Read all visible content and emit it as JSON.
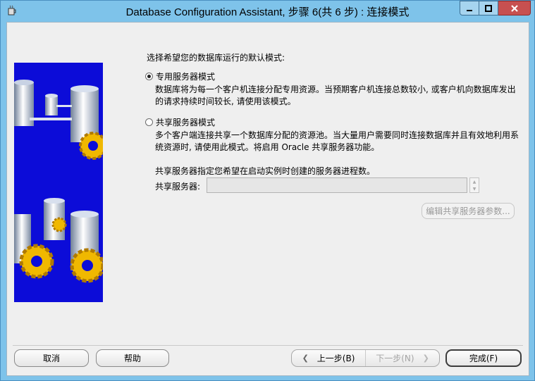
{
  "window": {
    "title": "Database Configuration Assistant, 步骤 6(共 6 步) : 连接模式"
  },
  "content": {
    "prompt": "选择希望您的数据库运行的默认模式:",
    "dedicated": {
      "label": "专用服务器模式",
      "selected": true,
      "desc1": "数据库将为每一个客户机连接分配专用资源。当预期客户机连接总数较小, 或客户机向数据库发出",
      "desc2": "的请求持续时间较长, 请使用该模式。"
    },
    "shared": {
      "label": "共享服务器模式",
      "selected": false,
      "desc1": "多个客户端连接共享一个数据库分配的资源池。当大量用户需要同时连接数据库并且有效地利用系",
      "desc2": "统资源时, 请使用此模式。将启用 Oracle 共享服务器功能。",
      "count_note": "共享服务器指定您希望在启动实例时创建的服务器进程数。",
      "count_label": "共享服务器:",
      "count_value": "",
      "edit_button": "编辑共享服务器参数..."
    }
  },
  "buttons": {
    "cancel": "取消",
    "help": "帮助",
    "back": "上一步(B)",
    "next": "下一步(N)",
    "finish": "完成(F)"
  },
  "icons": {
    "app": "java-cup-icon",
    "back": "chevron-left-icon",
    "next": "chevron-right-icon"
  }
}
